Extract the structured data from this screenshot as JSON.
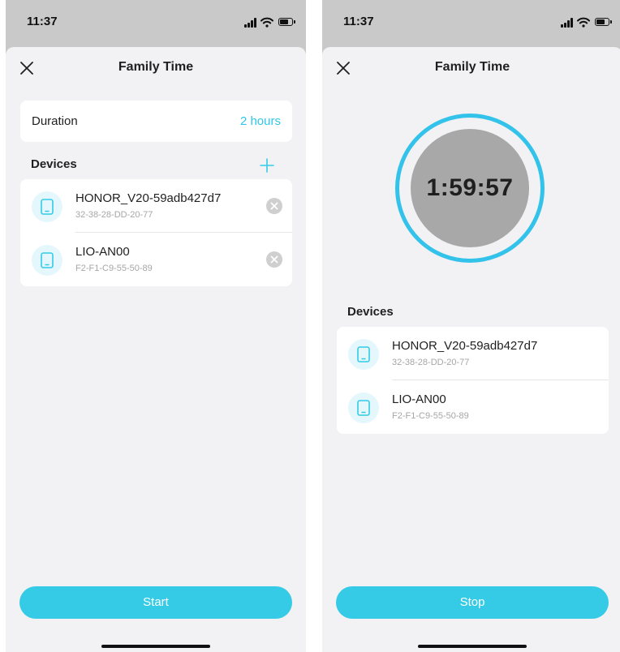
{
  "colors": {
    "accent": "#35cbe6",
    "timer_ring": "#33c2ea",
    "timer_fill": "#a8a8a8",
    "screen_bg": "#f2f2f4",
    "overlay_bg": "#c9c9c9"
  },
  "screens": [
    {
      "status_bar": {
        "time": "11:37",
        "icons": [
          "signal-icon",
          "wifi-icon",
          "battery-icon"
        ]
      },
      "header": {
        "title": "Family Time",
        "close_icon": "close-icon"
      },
      "duration": {
        "label": "Duration",
        "value": "2 hours"
      },
      "devices": {
        "label": "Devices",
        "add_icon": "plus-icon",
        "items": [
          {
            "name": "HONOR_V20-59adb427d7",
            "mac": "32-38-28-DD-20-77",
            "icon": "phone-icon",
            "remove_icon": "remove-icon"
          },
          {
            "name": "LIO-AN00",
            "mac": "F2-F1-C9-55-50-89",
            "icon": "phone-icon",
            "remove_icon": "remove-icon"
          }
        ]
      },
      "action_button": {
        "label": "Start"
      }
    },
    {
      "status_bar": {
        "time": "11:37",
        "icons": [
          "signal-icon",
          "wifi-icon",
          "battery-icon"
        ]
      },
      "header": {
        "title": "Family Time",
        "close_icon": "close-icon"
      },
      "timer": {
        "remaining": "1:59:57"
      },
      "devices": {
        "label": "Devices",
        "items": [
          {
            "name": "HONOR_V20-59adb427d7",
            "mac": "32-38-28-DD-20-77",
            "icon": "phone-icon"
          },
          {
            "name": "LIO-AN00",
            "mac": "F2-F1-C9-55-50-89",
            "icon": "phone-icon"
          }
        ]
      },
      "action_button": {
        "label": "Stop"
      }
    }
  ]
}
